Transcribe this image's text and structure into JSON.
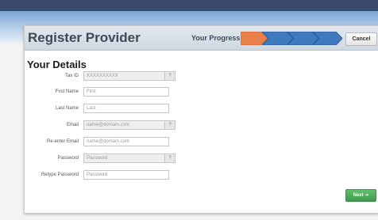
{
  "app": {
    "title": "Register Provider"
  },
  "progress": {
    "label": "Your Progress",
    "steps": 4,
    "current": 1,
    "active_color": "#e9804a",
    "inactive_color": "#3f79be"
  },
  "header": {
    "cancel_label": "Cancel"
  },
  "section": {
    "title": "Your Details"
  },
  "fields": [
    {
      "label": "Tax ID",
      "placeholder": "XXXXXXXXXX",
      "has_help": true,
      "help_label": "?"
    },
    {
      "label": "First Name",
      "placeholder": "First",
      "has_help": false
    },
    {
      "label": "Last Name",
      "placeholder": "Last",
      "has_help": false
    },
    {
      "label": "Email",
      "placeholder": "name@domain.com",
      "has_help": true,
      "help_label": "?"
    },
    {
      "label": "Re-enter Email",
      "placeholder": "name@domain.com",
      "has_help": false
    },
    {
      "label": "Password",
      "placeholder": "Password",
      "has_help": true,
      "help_label": "?"
    },
    {
      "label": "Retype Password",
      "placeholder": "Password",
      "has_help": false
    }
  ],
  "footer": {
    "next_label": "Next ➔"
  }
}
